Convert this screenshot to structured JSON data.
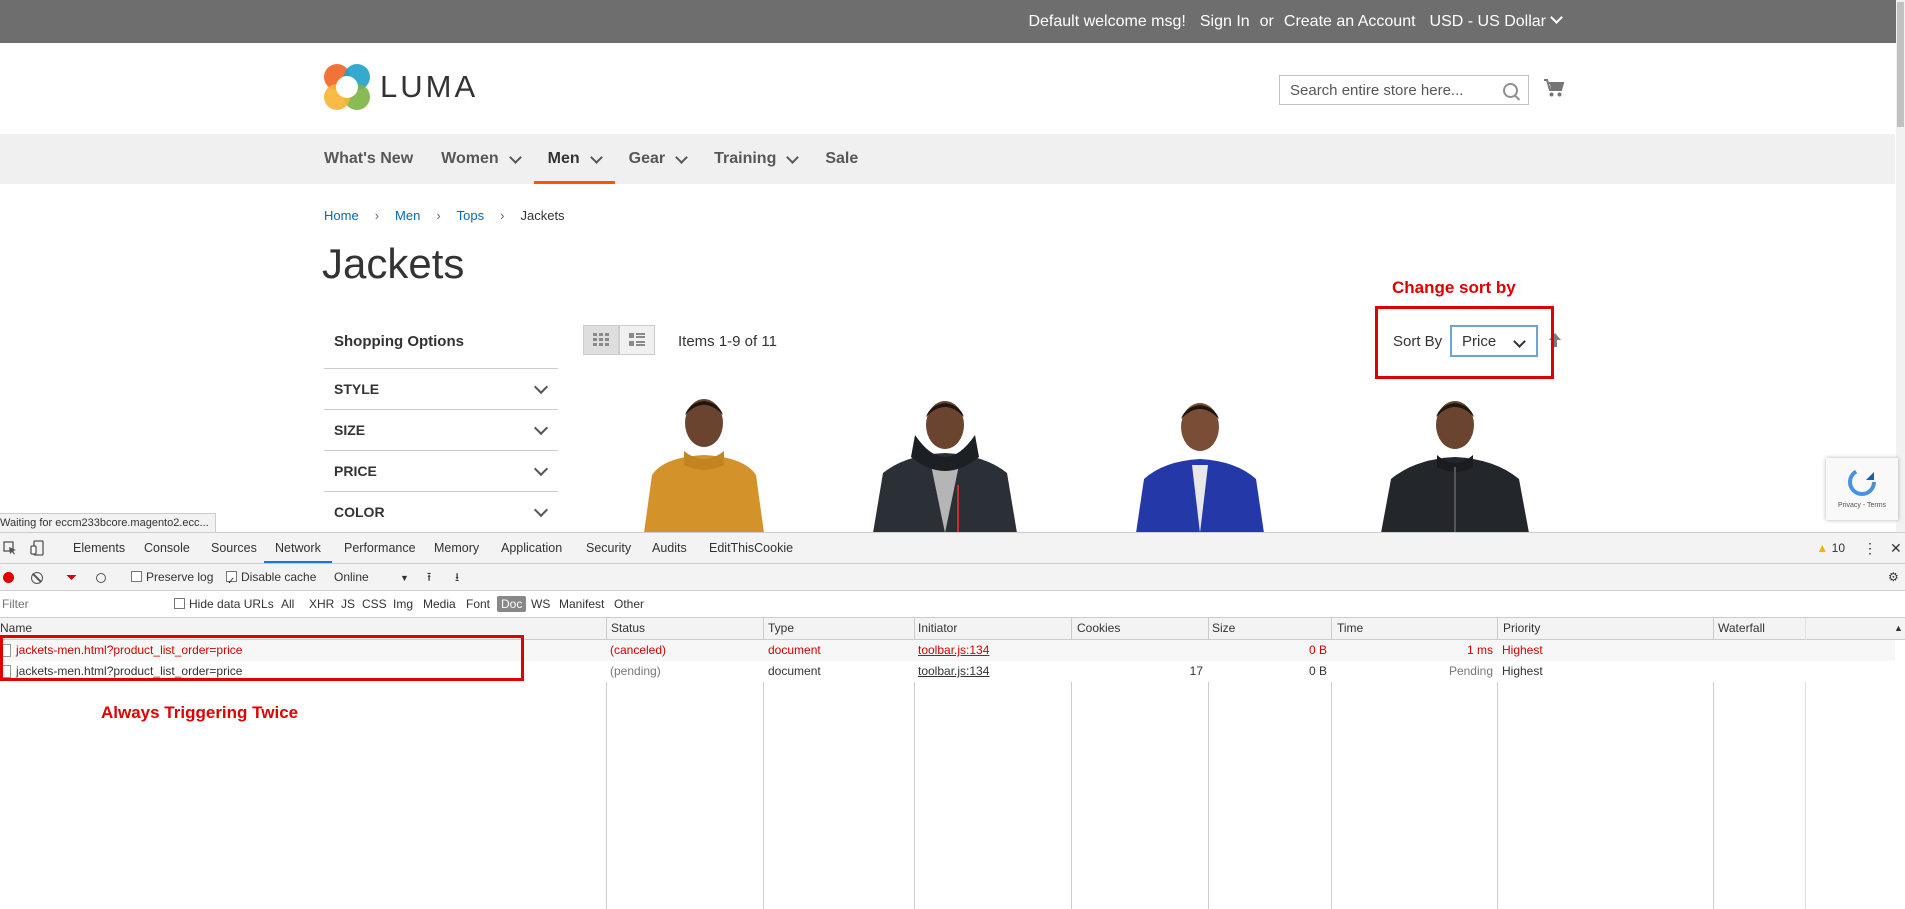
{
  "topbar": {
    "welcome": "Default welcome msg!",
    "sign_in": "Sign In",
    "or": "or",
    "create_account": "Create an Account",
    "currency": "USD - US Dollar"
  },
  "header": {
    "logo_text": "LUMA",
    "search_placeholder": "Search entire store here..."
  },
  "nav": {
    "items": [
      {
        "label": "What's New"
      },
      {
        "label": "Women"
      },
      {
        "label": "Men"
      },
      {
        "label": "Gear"
      },
      {
        "label": "Training"
      },
      {
        "label": "Sale"
      }
    ]
  },
  "breadcrumbs": [
    "Home",
    "Men",
    "Tops",
    "Jackets"
  ],
  "page_title": "Jackets",
  "sidebar": {
    "title": "Shopping Options",
    "filters": [
      "STYLE",
      "SIZE",
      "PRICE",
      "COLOR"
    ]
  },
  "toolbar": {
    "amount": "Items 1-9 of 11",
    "sort_by_label": "Sort By",
    "sort_value": "Price"
  },
  "annotations": {
    "sort": "Change sort by",
    "twice": "Always Triggering Twice"
  },
  "recaptcha": {
    "text": "Privacy - Terms"
  },
  "status_tooltip": "Waiting for eccm233bcore.magento2.ecc...",
  "devtools": {
    "tabs": [
      "Elements",
      "Console",
      "Sources",
      "Network",
      "Performance",
      "Memory",
      "Application",
      "Security",
      "Audits",
      "EditThisCookie"
    ],
    "active_tab": "Network",
    "warnings": "10",
    "preserve_log": "Preserve log",
    "disable_cache": "Disable cache",
    "throttle": "Online",
    "filter_placeholder": "Filter",
    "hide_data_urls": "Hide data URLs",
    "type_filters": [
      "All",
      "XHR",
      "JS",
      "CSS",
      "Img",
      "Media",
      "Font",
      "Doc",
      "WS",
      "Manifest",
      "Other"
    ],
    "columns": [
      "Name",
      "Status",
      "Type",
      "Initiator",
      "Cookies",
      "Size",
      "Time",
      "Priority",
      "Waterfall"
    ],
    "rows": [
      {
        "name": "jackets-men.html?product_list_order=price",
        "status": "(canceled)",
        "type": "document",
        "initiator": "toolbar.js:134",
        "cookies": "",
        "size": "0 B",
        "time": "1 ms",
        "priority": "Highest"
      },
      {
        "name": "jackets-men.html?product_list_order=price",
        "status": "(pending)",
        "type": "document",
        "initiator": "toolbar.js:134",
        "cookies": "17",
        "size": "0 B",
        "time": "Pending",
        "priority": "Highest"
      }
    ]
  },
  "colors": {
    "accent": "#ff5501",
    "annotation": "#e00000",
    "link": "#006bb4",
    "topbar": "#6e6e6e"
  }
}
